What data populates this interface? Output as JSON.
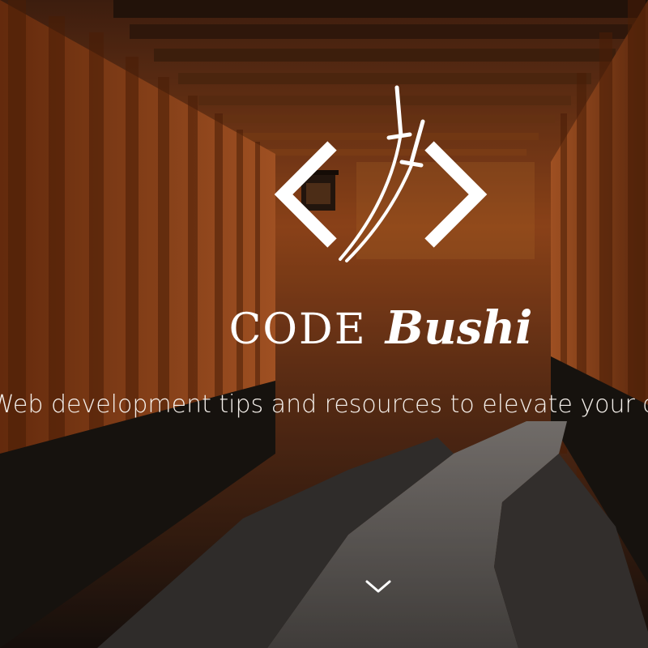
{
  "hero": {
    "brand_code": "CODE",
    "brand_bushi": "Bushi",
    "tagline": "Web development tips and resources to elevate your coding"
  },
  "icons": {
    "logo": "code-brackets-katana-icon",
    "scroll": "chevron-down-icon"
  },
  "colors": {
    "torii_orange": "#b8521a",
    "torii_dark": "#3a1e10",
    "path_gray": "#6a6662",
    "text_white": "#ffffff"
  }
}
